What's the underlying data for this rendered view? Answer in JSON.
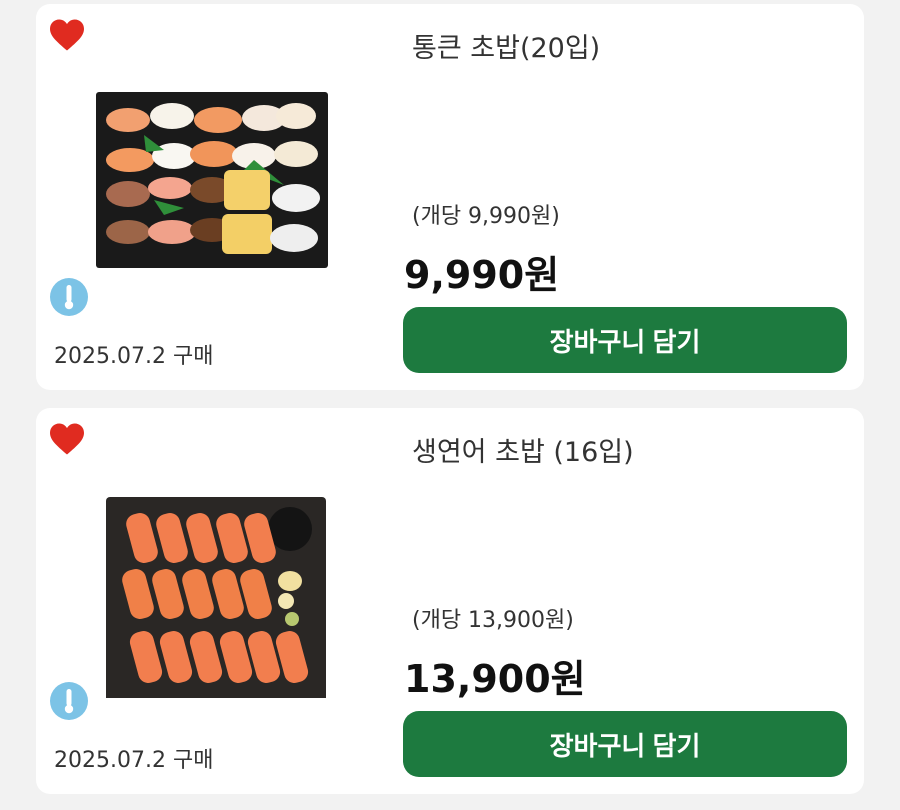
{
  "products": [
    {
      "title": "통큰 초밥(20입)",
      "unit_price": "(개당 9,990원)",
      "price": "9,990원",
      "purchase_date": "2025.07.2 구매",
      "cart_button_label": "장바구니 담기"
    },
    {
      "title": "생연어 초밥 (16입)",
      "unit_price": "(개당 13,900원)",
      "price": "13,900원",
      "purchase_date": "2025.07.2 구매",
      "cart_button_label": "장바구니 담기"
    }
  ],
  "colors": {
    "button_green": "#1d7a3f",
    "heart_red": "#e02b20",
    "temp_icon_blue": "#7cc3e6"
  },
  "icons": [
    "heart-icon",
    "thermometer-icon"
  ]
}
